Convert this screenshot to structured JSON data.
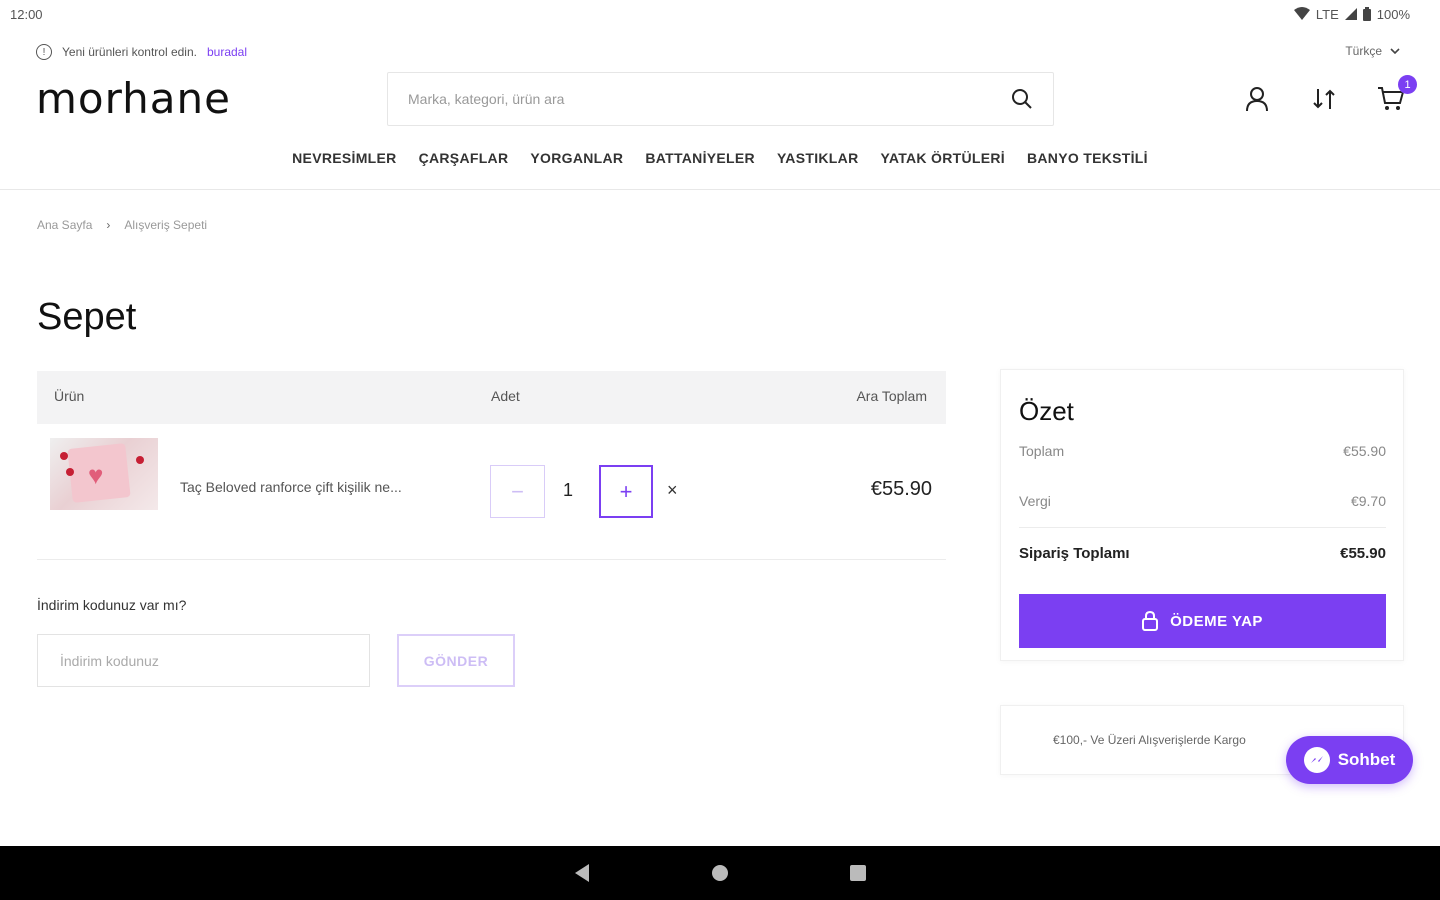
{
  "status_bar": {
    "time": "12:00",
    "network": "LTE",
    "battery": "100%"
  },
  "top_info": {
    "text": "Yeni ürünleri kontrol edin.",
    "link": "buradal"
  },
  "language": {
    "selected": "Türkçe"
  },
  "header": {
    "logo": "morhane",
    "search_placeholder": "Marka, kategori, ürün ara",
    "cart_count": "1"
  },
  "nav": {
    "items": [
      {
        "label": "NEVRESİMLER"
      },
      {
        "label": "ÇARŞAFLAR"
      },
      {
        "label": "YORGANLAR"
      },
      {
        "label": "BATTANİYELER"
      },
      {
        "label": "YASTIKLAR"
      },
      {
        "label": "YATAK ÖRTÜLERİ"
      },
      {
        "label": "BANYO TEKSTİLİ"
      }
    ]
  },
  "breadcrumb": {
    "home": "Ana Sayfa",
    "separator": "›",
    "current": "Alışveriş Sepeti"
  },
  "page": {
    "title": "Sepet"
  },
  "cart": {
    "headers": {
      "product": "Ürün",
      "quantity": "Adet",
      "subtotal": "Ara Toplam"
    },
    "items": [
      {
        "name": "Taç Beloved ranforce çift kişilik ne...",
        "quantity": "1",
        "minus": "−",
        "plus": "+",
        "remove": "×",
        "price": "€55.90"
      }
    ]
  },
  "discount": {
    "label": "İndirim kodunuz var mı?",
    "placeholder": "İndirim kodunuz",
    "button": "GÖNDER"
  },
  "summary": {
    "title": "Özet",
    "total_label": "Toplam",
    "total_value": "€55.90",
    "tax_label": "Vergi",
    "tax_value": "€9.70",
    "order_total_label": "Sipariş Toplamı",
    "order_total_value": "€55.90",
    "pay_button": "ÖDEME YAP"
  },
  "shipping_note": {
    "text": "€100,- Ve Üzeri Alışverişlerde Kargo"
  },
  "chat": {
    "label": "Sohbet"
  },
  "colors": {
    "accent": "#7b3ff2",
    "accent_light": "#dccff9"
  }
}
